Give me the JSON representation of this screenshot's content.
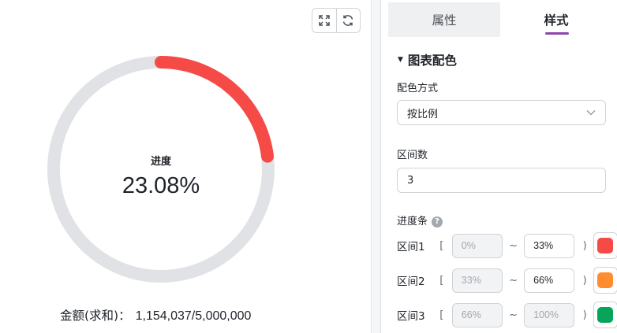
{
  "chart": {
    "center_label": "进度",
    "center_value": "23.08%",
    "summary_label": "金额(求和)：",
    "summary_value": "1,154,037/5,000,000",
    "progress_fraction": 0.2308,
    "progress_color": "#f54a45",
    "track_color": "#e1e2e6"
  },
  "chart_data": {
    "type": "pie",
    "title": "进度",
    "values": [
      1154037,
      5000000
    ],
    "percent": 23.08,
    "label": "金额(求和)"
  },
  "toolbar": {
    "fullscreen_icon": "expand-icon",
    "refresh_icon": "refresh-icon"
  },
  "settings": {
    "tabs": [
      {
        "label": "属性",
        "active": false
      },
      {
        "label": "样式",
        "active": true
      }
    ],
    "accent_color": "#8e44ad",
    "section_title": "图表配色",
    "color_mode_label": "配色方式",
    "color_mode_value": "按比例",
    "interval_count_label": "区间数",
    "interval_count_value": "3",
    "progress_bar_label": "进度条",
    "help_icon": "?",
    "ranges": [
      {
        "label": "区间1",
        "open": "[",
        "from": "0%",
        "tilde": "~",
        "to": "33%",
        "close": ")",
        "color": "#f54a45"
      },
      {
        "label": "区间2",
        "open": "[",
        "from": "33%",
        "tilde": "~",
        "to": "66%",
        "close": ")",
        "color": "#ff8c2e"
      },
      {
        "label": "区间3",
        "open": "[",
        "from": "66%",
        "tilde": "~",
        "to": "100%",
        "close": ")",
        "color": "#07a45c"
      }
    ]
  }
}
